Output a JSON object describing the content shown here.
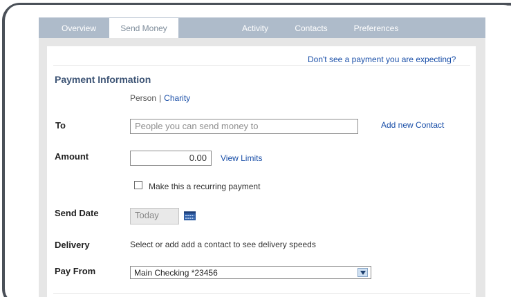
{
  "nav": {
    "tabs": [
      {
        "label": "Overview",
        "active": false
      },
      {
        "label": "Send Money",
        "active": true
      },
      {
        "label": "Activity",
        "active": false
      },
      {
        "label": "Contacts",
        "active": false
      },
      {
        "label": "Preferences",
        "active": false
      }
    ]
  },
  "header": {
    "expecting_link": "Don't see a payment you are expecting?"
  },
  "payment": {
    "section_title": "Payment Information",
    "recipient_type": {
      "person": "Person",
      "separator": "|",
      "charity": "Charity"
    },
    "to": {
      "label": "To",
      "placeholder": "People you can send money to",
      "add_contact_link": "Add new Contact"
    },
    "amount": {
      "label": "Amount",
      "value": "0.00",
      "view_limits_link": "View Limits"
    },
    "recurring": {
      "label": "Make this a recurring payment",
      "checked": false
    },
    "send_date": {
      "label": "Send Date",
      "value": "Today",
      "calendar_icon": "calendar-icon"
    },
    "delivery": {
      "label": "Delivery",
      "text": "Select or add add a contact to see delivery speeds"
    },
    "pay_from": {
      "label": "Pay From",
      "selected": "Main Checking *23456",
      "dropdown_icon": "chevron-down-icon"
    }
  },
  "colors": {
    "nav_bg": "#aebbca",
    "link": "#1a4fa8",
    "section_title": "#3d5475",
    "frame": "#4a5058"
  }
}
